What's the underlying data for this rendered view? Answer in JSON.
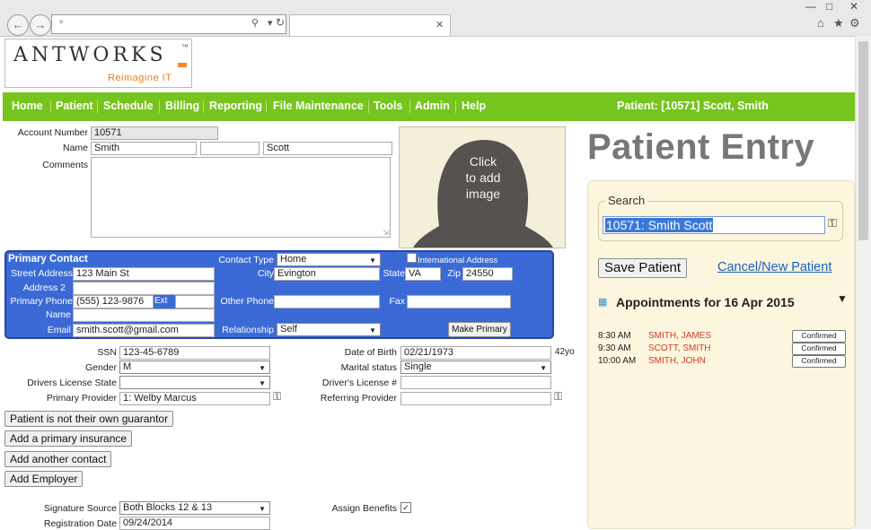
{
  "browser": {
    "back_icon": "back-arrow-icon",
    "forward_icon": "forward-arrow-icon",
    "controls": [
      "search-icon",
      "refresh-icon"
    ],
    "window_controls": [
      "minimize-icon",
      "maximize-icon",
      "close-icon"
    ],
    "toolbar_icons": [
      "home-icon",
      "star-icon",
      "gear-icon"
    ]
  },
  "logo": {
    "name": "ANTWORKS",
    "tm": "™",
    "tagline": "Reimagine IT"
  },
  "nav": {
    "items": [
      "Home",
      "Patient",
      "Schedule",
      "Billing",
      "Reporting",
      "File Maintenance",
      "Tools",
      "Admin",
      "Help"
    ],
    "patient_info": "Patient: [10571] Scott, Smith"
  },
  "form": {
    "account_number_label": "Account Number",
    "account_number": "10571",
    "name_label": "Name",
    "last_name": "Smith",
    "middle_name": "",
    "first_name": "Scott",
    "comments_label": "Comments",
    "photo_text_1": "Click",
    "photo_text_2": "to add",
    "photo_text_3": "image"
  },
  "primary_contact": {
    "title": "Primary Contact",
    "contact_type_label": "Contact Type",
    "contact_type": "Home",
    "international_label": "International Address",
    "street_label": "Street Address",
    "street": "123 Main St",
    "address2_label": "Address 2",
    "city_label": "City",
    "city": "Evington",
    "state_label": "State",
    "state": "VA",
    "zip_label": "Zip",
    "zip": "24550",
    "phone_label": "Primary Phone",
    "phone": "(555) 123-9876",
    "ext_label": "Ext",
    "other_phone_label": "Other Phone",
    "fax_label": "Fax",
    "name_label": "Name",
    "email_label": "Email",
    "email": "smith.scott@gmail.com",
    "relationship_label": "Relationship",
    "relationship": "Self",
    "make_primary": "Make Primary"
  },
  "details": {
    "ssn_label": "SSN",
    "ssn": "123-45-6789",
    "dob_label": "Date of Birth",
    "dob": "02/21/1973",
    "age": "42yo",
    "gender_label": "Gender",
    "gender": "M",
    "marital_label": "Marital status",
    "marital": "Single",
    "dl_state_label": "Drivers License State",
    "dl_state": "",
    "dl_number_label": "Driver's License #",
    "dl_number": "",
    "primary_provider_label": "Primary Provider",
    "primary_provider": "1: Welby Marcus",
    "referring_provider_label": "Referring Provider",
    "referring_provider": "",
    "signature_source_label": "Signature Source",
    "signature_source": "Both Blocks 12 & 13",
    "assign_benefits_label": "Assign Benefits",
    "registration_date_label": "Registration Date",
    "registration_date": "09/24/2014"
  },
  "buttons": {
    "guarantor": "Patient is not their own guarantor",
    "insurance": "Add a primary insurance",
    "contact": "Add another contact",
    "employer": "Add Employer"
  },
  "right": {
    "page_title": "Patient Entry",
    "search_legend": "Search",
    "search_value": "10571: Smith Scott",
    "save_label": "Save Patient",
    "cancel_label": "Cancel/New Patient",
    "appointments_title": "Appointments for 16 Apr 2015",
    "appointments": [
      {
        "time": "8:30 AM",
        "name": "SMITH, JAMES",
        "status": "Confirmed"
      },
      {
        "time": "9:30 AM",
        "name": "SCOTT, SMITH",
        "status": "Confirmed"
      },
      {
        "time": "10:00 AM",
        "name": "SMITH, JOHN",
        "status": "Confirmed"
      }
    ]
  },
  "colors": {
    "nav_green": "#76c41e",
    "contact_blue": "#3b6ad6",
    "title_gray": "#777777",
    "link_blue": "#1a5fc2",
    "appt_red": "#d23a2a",
    "panel_yellow": "#fcf6de"
  }
}
